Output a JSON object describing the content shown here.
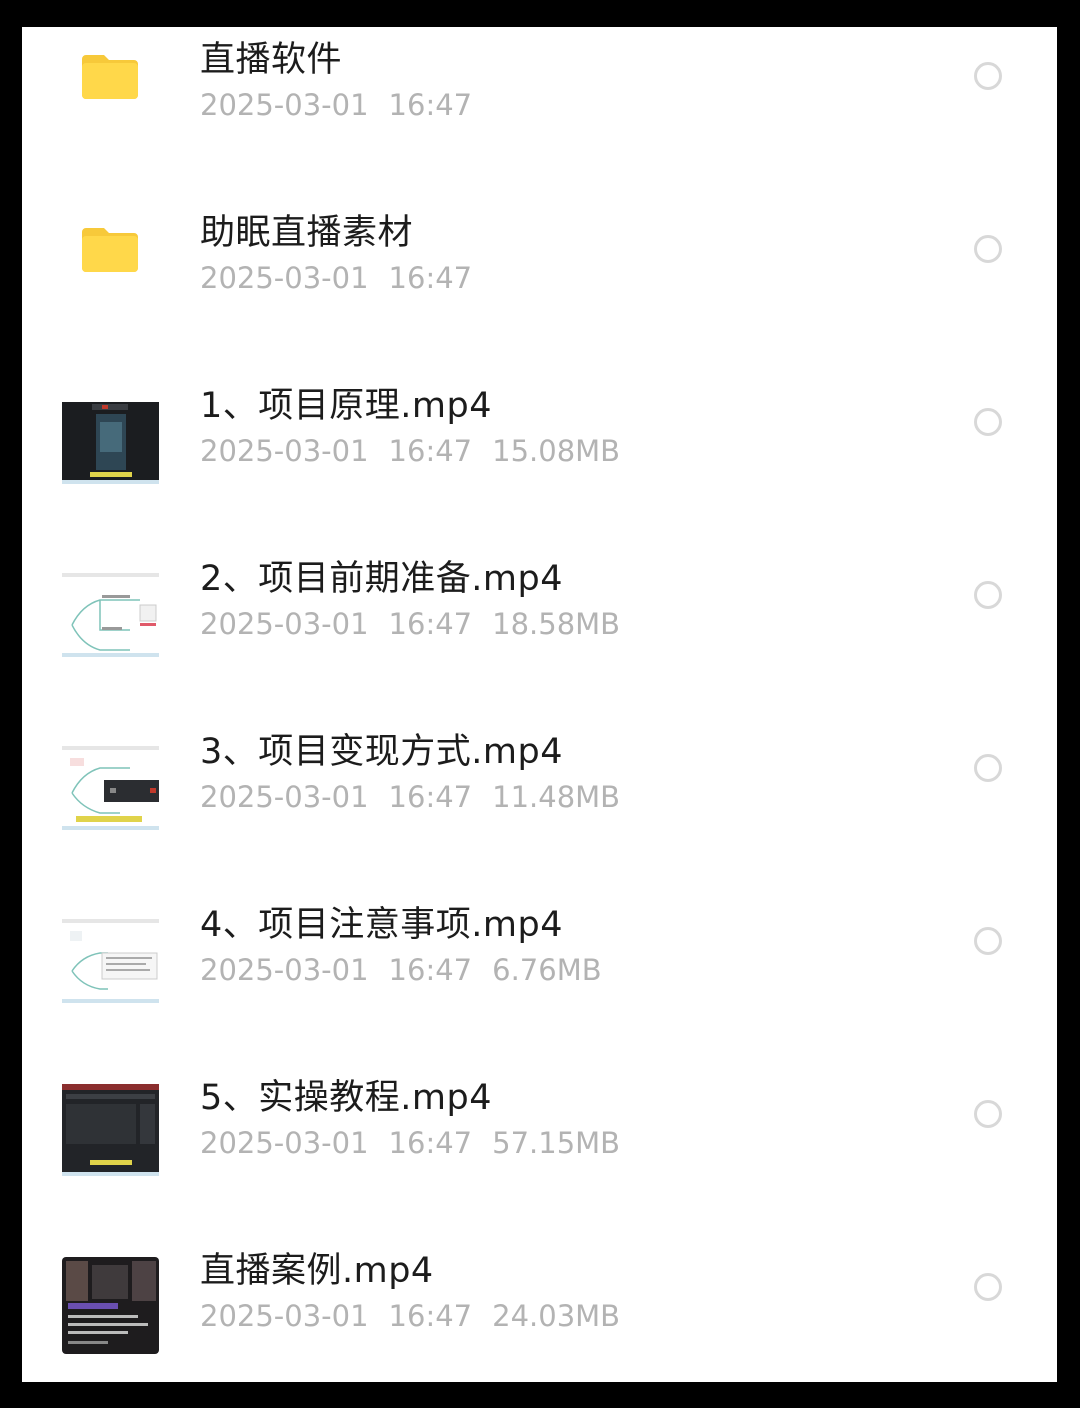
{
  "files": [
    {
      "name": "直播软件",
      "date": "2025-03-01",
      "time": "16:47",
      "size": "",
      "type": "folder"
    },
    {
      "name": "助眠直播素材",
      "date": "2025-03-01",
      "time": "16:47",
      "size": "",
      "type": "folder"
    },
    {
      "name": "1、项目原理.mp4",
      "date": "2025-03-01",
      "time": "16:47",
      "size": "15.08MB",
      "type": "video",
      "thumb": "dark"
    },
    {
      "name": "2、项目前期准备.mp4",
      "date": "2025-03-01",
      "time": "16:47",
      "size": "18.58MB",
      "type": "video",
      "thumb": "mindmap"
    },
    {
      "name": "3、项目变现方式.mp4",
      "date": "2025-03-01",
      "time": "16:47",
      "size": "11.48MB",
      "type": "video",
      "thumb": "mindmap-dialog"
    },
    {
      "name": "4、项目注意事项.mp4",
      "date": "2025-03-01",
      "time": "16:47",
      "size": "6.76MB",
      "type": "video",
      "thumb": "mindmap"
    },
    {
      "name": "5、实操教程.mp4",
      "date": "2025-03-01",
      "time": "16:47",
      "size": "57.15MB",
      "type": "video",
      "thumb": "dark-app"
    },
    {
      "name": "直播案例.mp4",
      "date": "2025-03-01",
      "time": "16:47",
      "size": "24.03MB",
      "type": "video",
      "thumb": "room"
    }
  ],
  "colors": {
    "folder": "#FFD84A",
    "folder_tab": "#F7C93A",
    "name": "#1c1c1c",
    "meta": "#b3b3b3",
    "radio": "#d8d8d8"
  }
}
